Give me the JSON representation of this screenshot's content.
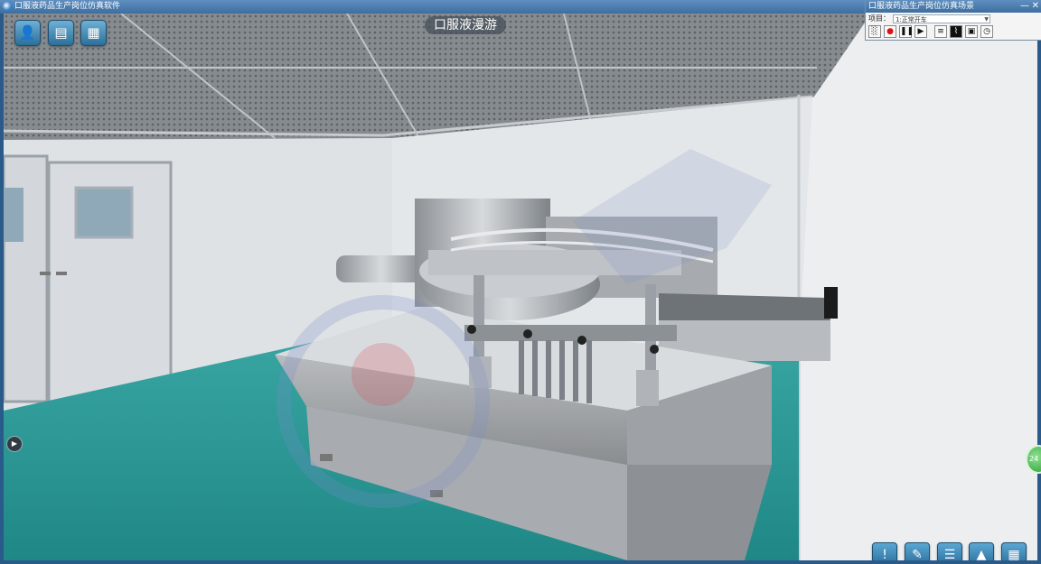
{
  "app": {
    "title": "口服液药品生产岗位仿真软件"
  },
  "scene": {
    "title": "口服液漫游"
  },
  "panel": {
    "title": "口服液药品生产岗位仿真场景",
    "minimize": "—",
    "close": "✕",
    "project_label": "项目：",
    "project_value": "1:正常开车",
    "buttons": [
      "grid-icon",
      "record-icon",
      "pause-icon",
      "play-icon",
      "list-icon",
      "chart-icon",
      "camera-icon",
      "clock-icon"
    ]
  },
  "toolbar_top": [
    "user-icon",
    "inventory-icon",
    "book-icon"
  ],
  "toolbar_bottom": [
    "alert-icon",
    "edit-icon",
    "checklist-icon",
    "graduation-icon",
    "menu-icon"
  ],
  "badge": {
    "label": "24"
  },
  "colors": {
    "floor": "#2a9a98",
    "wall": "#e9ebee",
    "ceiling": "#8f9499",
    "accent": "#2b6f98"
  }
}
